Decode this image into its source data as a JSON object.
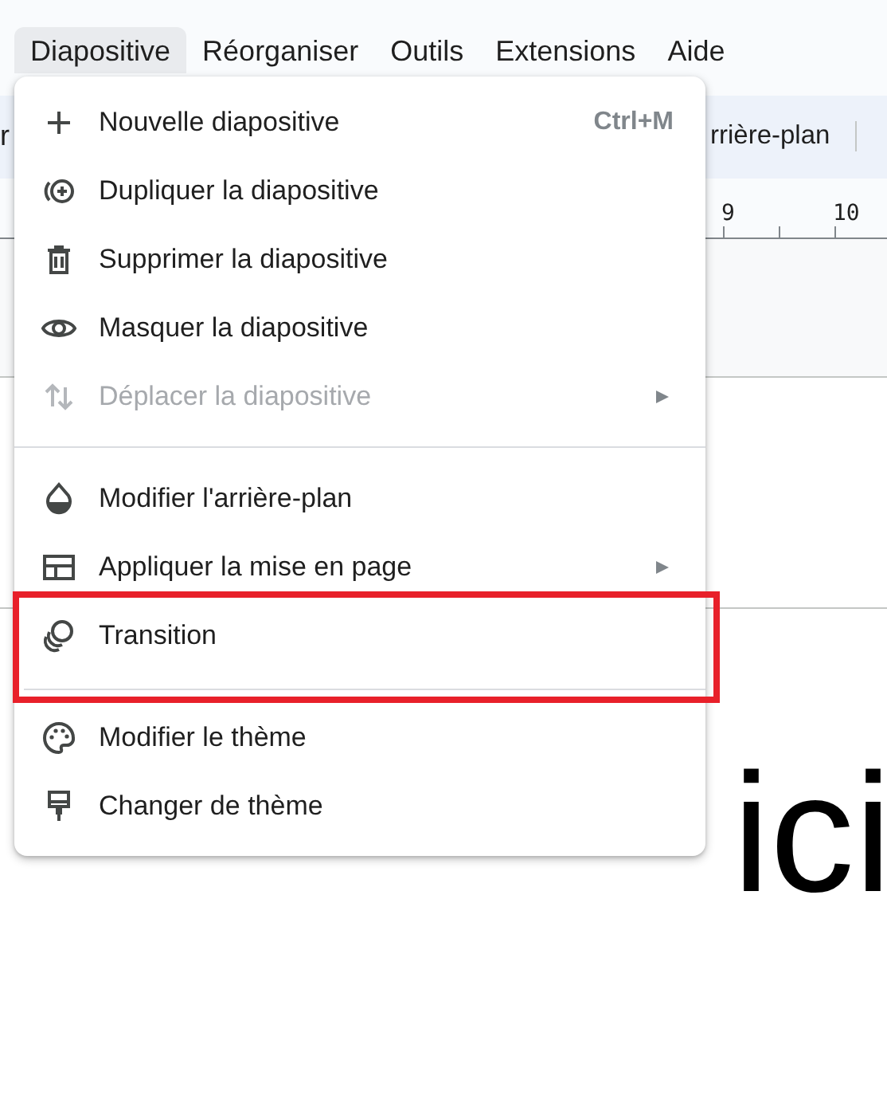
{
  "menu_bar": [
    {
      "label": "Diapositive",
      "selected": true
    },
    {
      "label": "Réorganiser",
      "selected": false
    },
    {
      "label": "Outils",
      "selected": false
    },
    {
      "label": "Extensions",
      "selected": false
    },
    {
      "label": "Aide",
      "selected": false
    }
  ],
  "toolbar": {
    "left_text": "r",
    "right_text": "rrière-plan"
  },
  "ruler": {
    "labels": [
      "9",
      "10"
    ]
  },
  "slide": {
    "text": "ici"
  },
  "dropdown": {
    "groups": [
      [
        {
          "label": "Nouvelle diapositive",
          "shortcut": "Ctrl+M",
          "disabled": false,
          "submenu": false,
          "highlighted": false
        },
        {
          "label": "Dupliquer la diapositive",
          "disabled": false,
          "submenu": false,
          "highlighted": false
        },
        {
          "label": "Supprimer la diapositive",
          "disabled": false,
          "submenu": false,
          "highlighted": false
        },
        {
          "label": "Masquer la diapositive",
          "disabled": false,
          "submenu": false,
          "highlighted": false
        },
        {
          "label": "Déplacer la diapositive",
          "disabled": true,
          "submenu": true,
          "highlighted": false
        }
      ],
      [
        {
          "label": "Modifier l'arrière-plan",
          "disabled": false,
          "submenu": false,
          "highlighted": false
        },
        {
          "label": "Appliquer la mise en page",
          "disabled": false,
          "submenu": true,
          "highlighted": false
        },
        {
          "label": "Transition",
          "disabled": false,
          "submenu": false,
          "highlighted": true
        }
      ],
      [
        {
          "label": "Modifier le thème",
          "disabled": false,
          "submenu": false,
          "highlighted": false
        },
        {
          "label": "Changer de thème",
          "disabled": false,
          "submenu": false,
          "highlighted": false
        }
      ]
    ]
  }
}
